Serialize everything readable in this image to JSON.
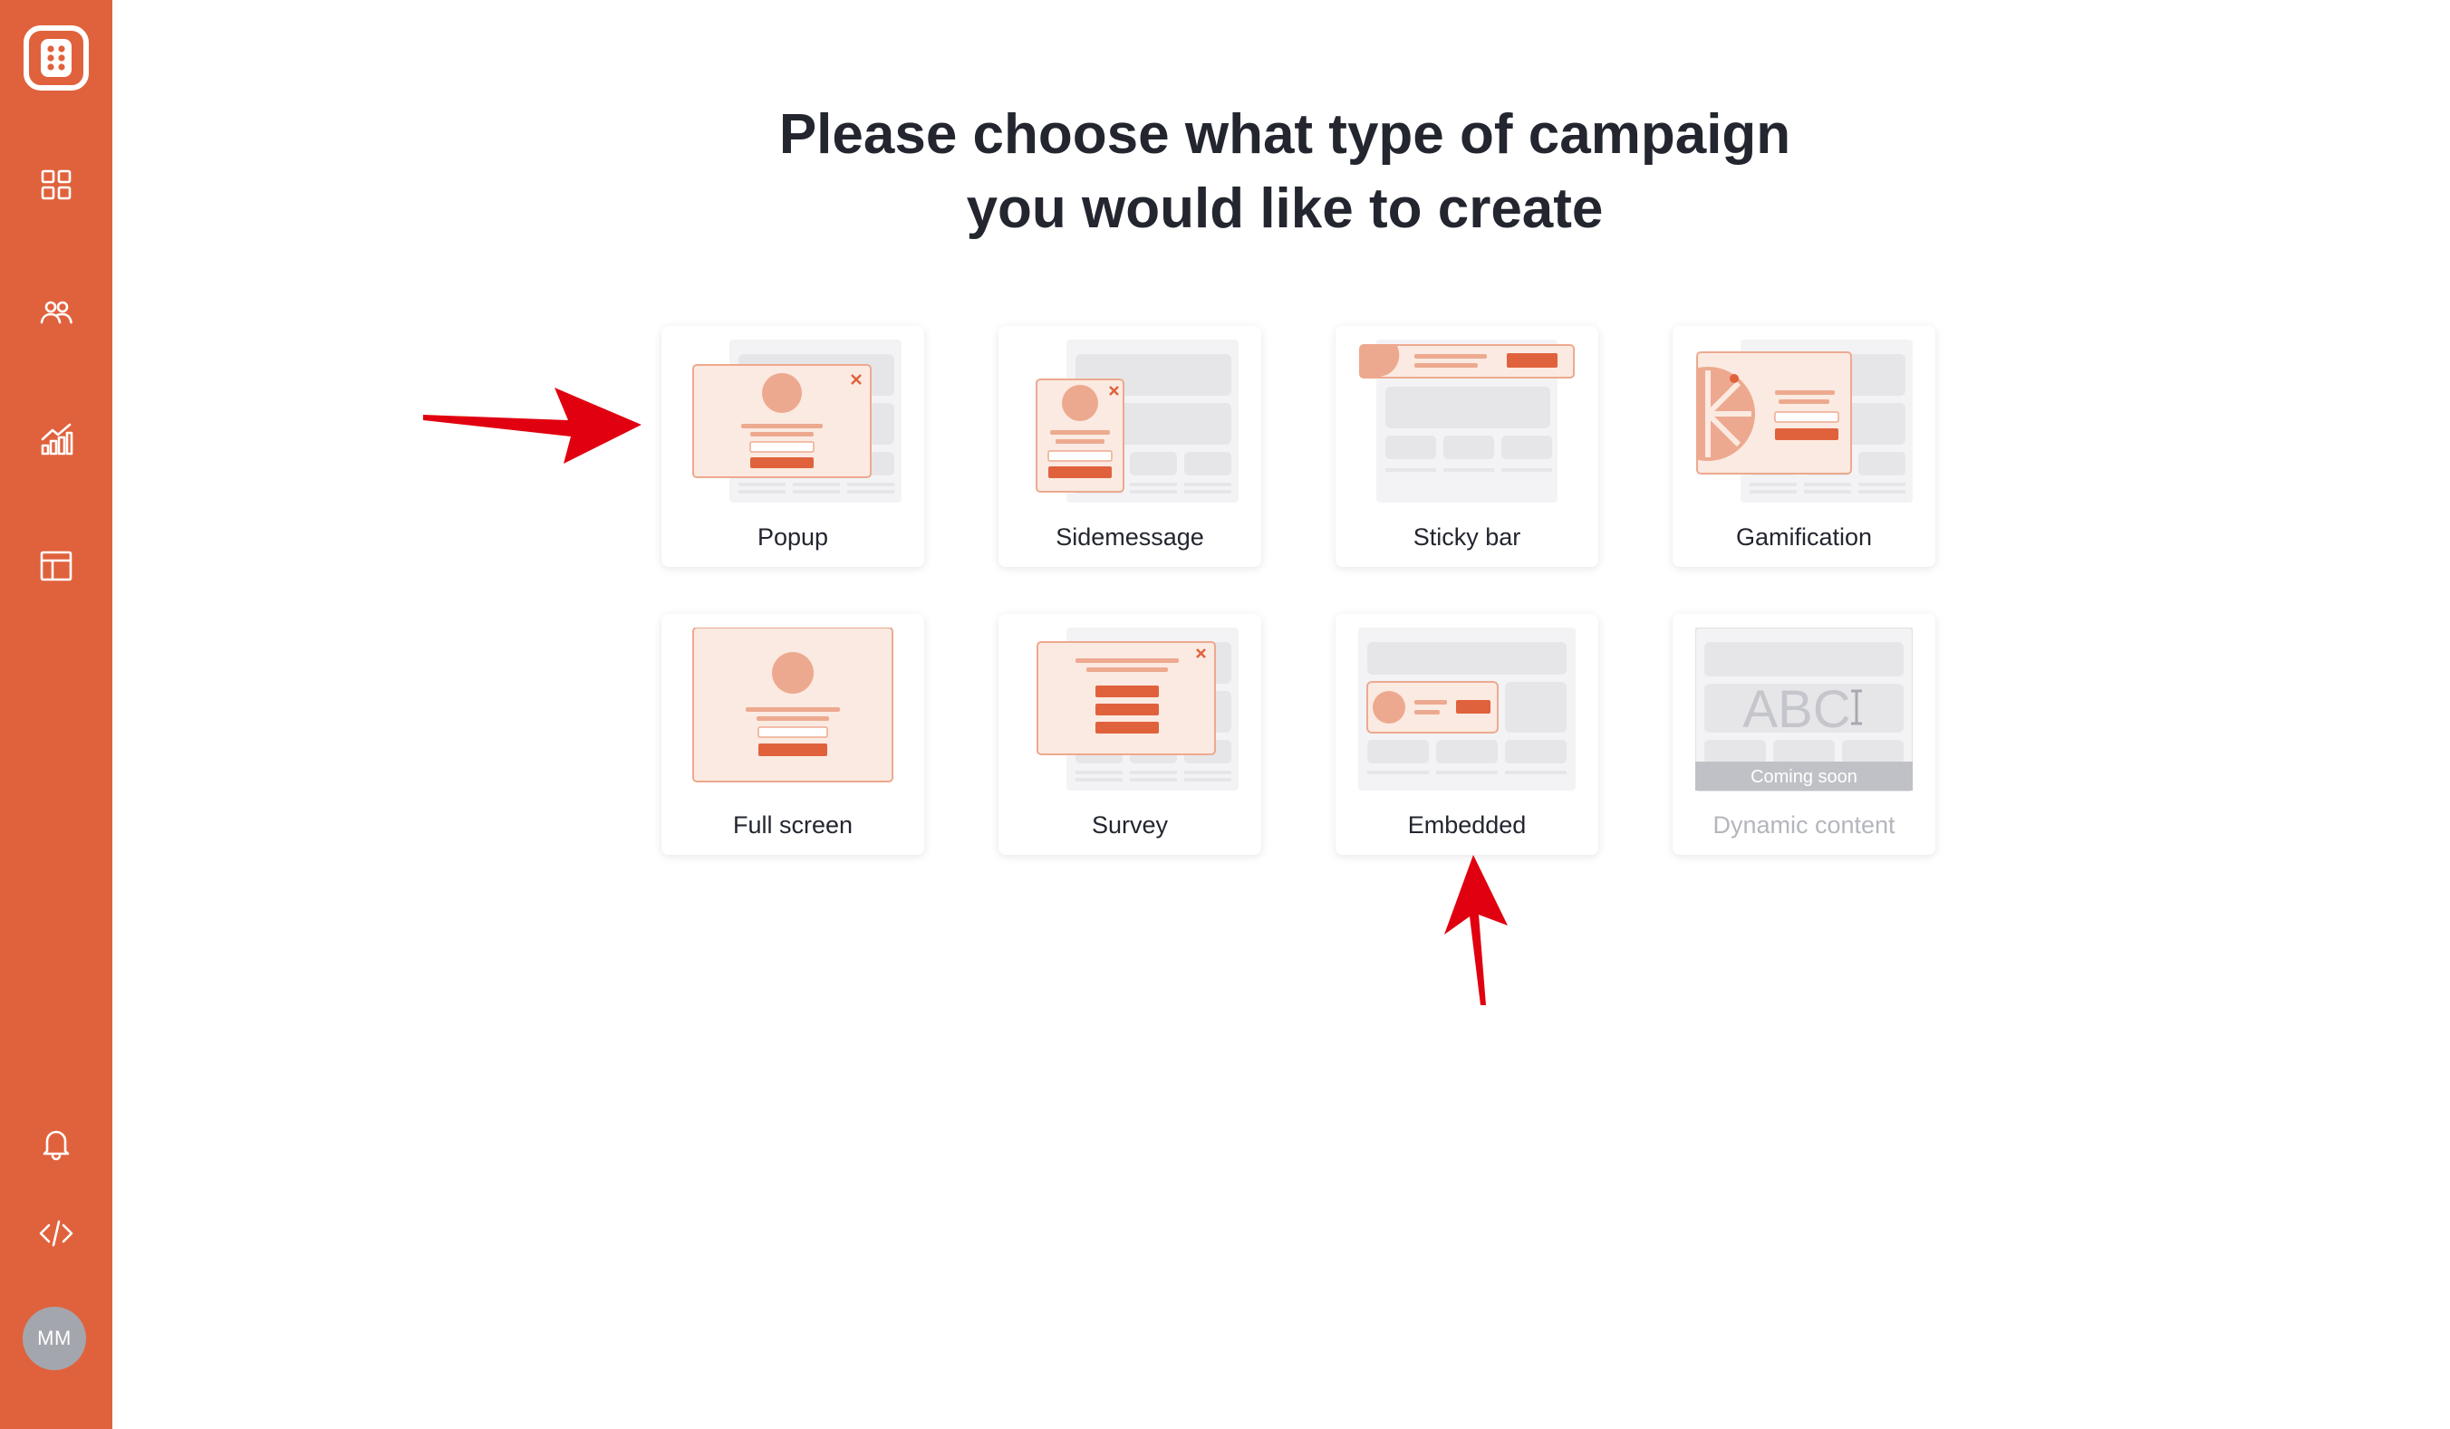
{
  "sidebar": {
    "brand_icon": "dots-grid-logo-icon",
    "items": [
      {
        "icon": "dashboard-icon"
      },
      {
        "icon": "users-icon"
      },
      {
        "icon": "analytics-icon"
      },
      {
        "icon": "layout-icon"
      }
    ],
    "bottom": [
      {
        "icon": "bell-icon"
      },
      {
        "icon": "code-icon"
      }
    ],
    "avatar_initials": "MM"
  },
  "main": {
    "title_line1": "Please choose what type of campaign",
    "title_line2": "you would like to create",
    "campaign_types": [
      {
        "label": "Popup"
      },
      {
        "label": "Sidemessage"
      },
      {
        "label": "Sticky bar"
      },
      {
        "label": "Gamification"
      },
      {
        "label": "Full screen"
      },
      {
        "label": "Survey"
      },
      {
        "label": "Embedded"
      },
      {
        "label": "Dynamic content",
        "badge": "Coming soon",
        "preview_text": "ABC",
        "disabled": true
      }
    ]
  },
  "colors": {
    "brand": "#E0623D",
    "accent_light": "#FBEAE1",
    "accent_mid": "#EDA98F",
    "annotation_arrow": "#E0000F"
  }
}
